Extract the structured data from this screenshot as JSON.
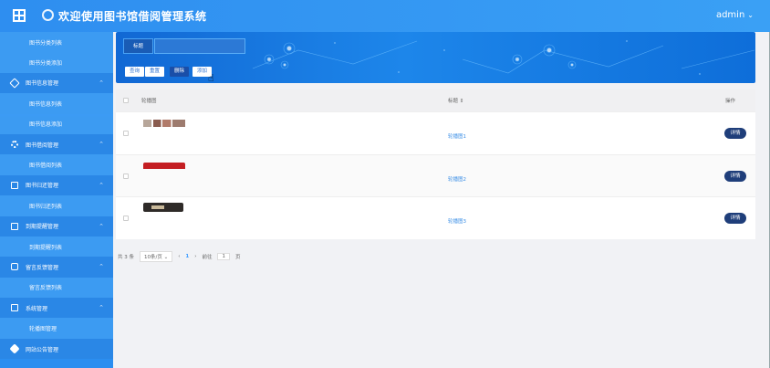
{
  "header": {
    "title": "欢迎使用图书馆借阅管理系统",
    "user": "admin"
  },
  "sidebar": {
    "items": [
      {
        "type": "sub",
        "label": "图书分类列表"
      },
      {
        "type": "sub",
        "label": "图书分类添加"
      },
      {
        "type": "group",
        "label": "图书信息管理",
        "icon": "tag-icon"
      },
      {
        "type": "sub",
        "label": "图书信息列表"
      },
      {
        "type": "sub",
        "label": "图书信息添加"
      },
      {
        "type": "group",
        "label": "图书借阅管理",
        "icon": "gear-icon"
      },
      {
        "type": "sub",
        "label": "图书借阅列表"
      },
      {
        "type": "group",
        "label": "图书归还管理",
        "icon": "box-icon"
      },
      {
        "type": "sub",
        "label": "图书归还列表"
      },
      {
        "type": "group",
        "label": "到期提醒管理",
        "icon": "doc-icon"
      },
      {
        "type": "sub",
        "label": "到期提醒列表"
      },
      {
        "type": "group",
        "label": "留言反馈管理",
        "icon": "chat-icon"
      },
      {
        "type": "sub",
        "label": "留言反馈列表"
      },
      {
        "type": "group",
        "label": "系统管理",
        "icon": "box-icon"
      },
      {
        "type": "sub",
        "label": "轮播图管理"
      },
      {
        "type": "group",
        "label": "网站公告管理",
        "icon": "pen-icon"
      }
    ]
  },
  "search": {
    "label": "标题",
    "placeholder": ""
  },
  "toolbar": {
    "query": "查询",
    "reset": "重置",
    "delete": "删除",
    "add": "添加"
  },
  "table": {
    "headers": {
      "image": "轮播图",
      "title": "标题 ⇕",
      "op": "操作"
    },
    "rows": [
      {
        "title": "轮播图1",
        "action": "详情"
      },
      {
        "title": "轮播图2",
        "action": "详情"
      },
      {
        "title": "轮播图3",
        "action": "详情"
      }
    ]
  },
  "pager": {
    "total": "共 3 条",
    "size": "10条/页 ⌄",
    "prev": "‹",
    "page": "1",
    "next": "›",
    "goto": "前往",
    "goto_val": "1",
    "unit": "页"
  }
}
